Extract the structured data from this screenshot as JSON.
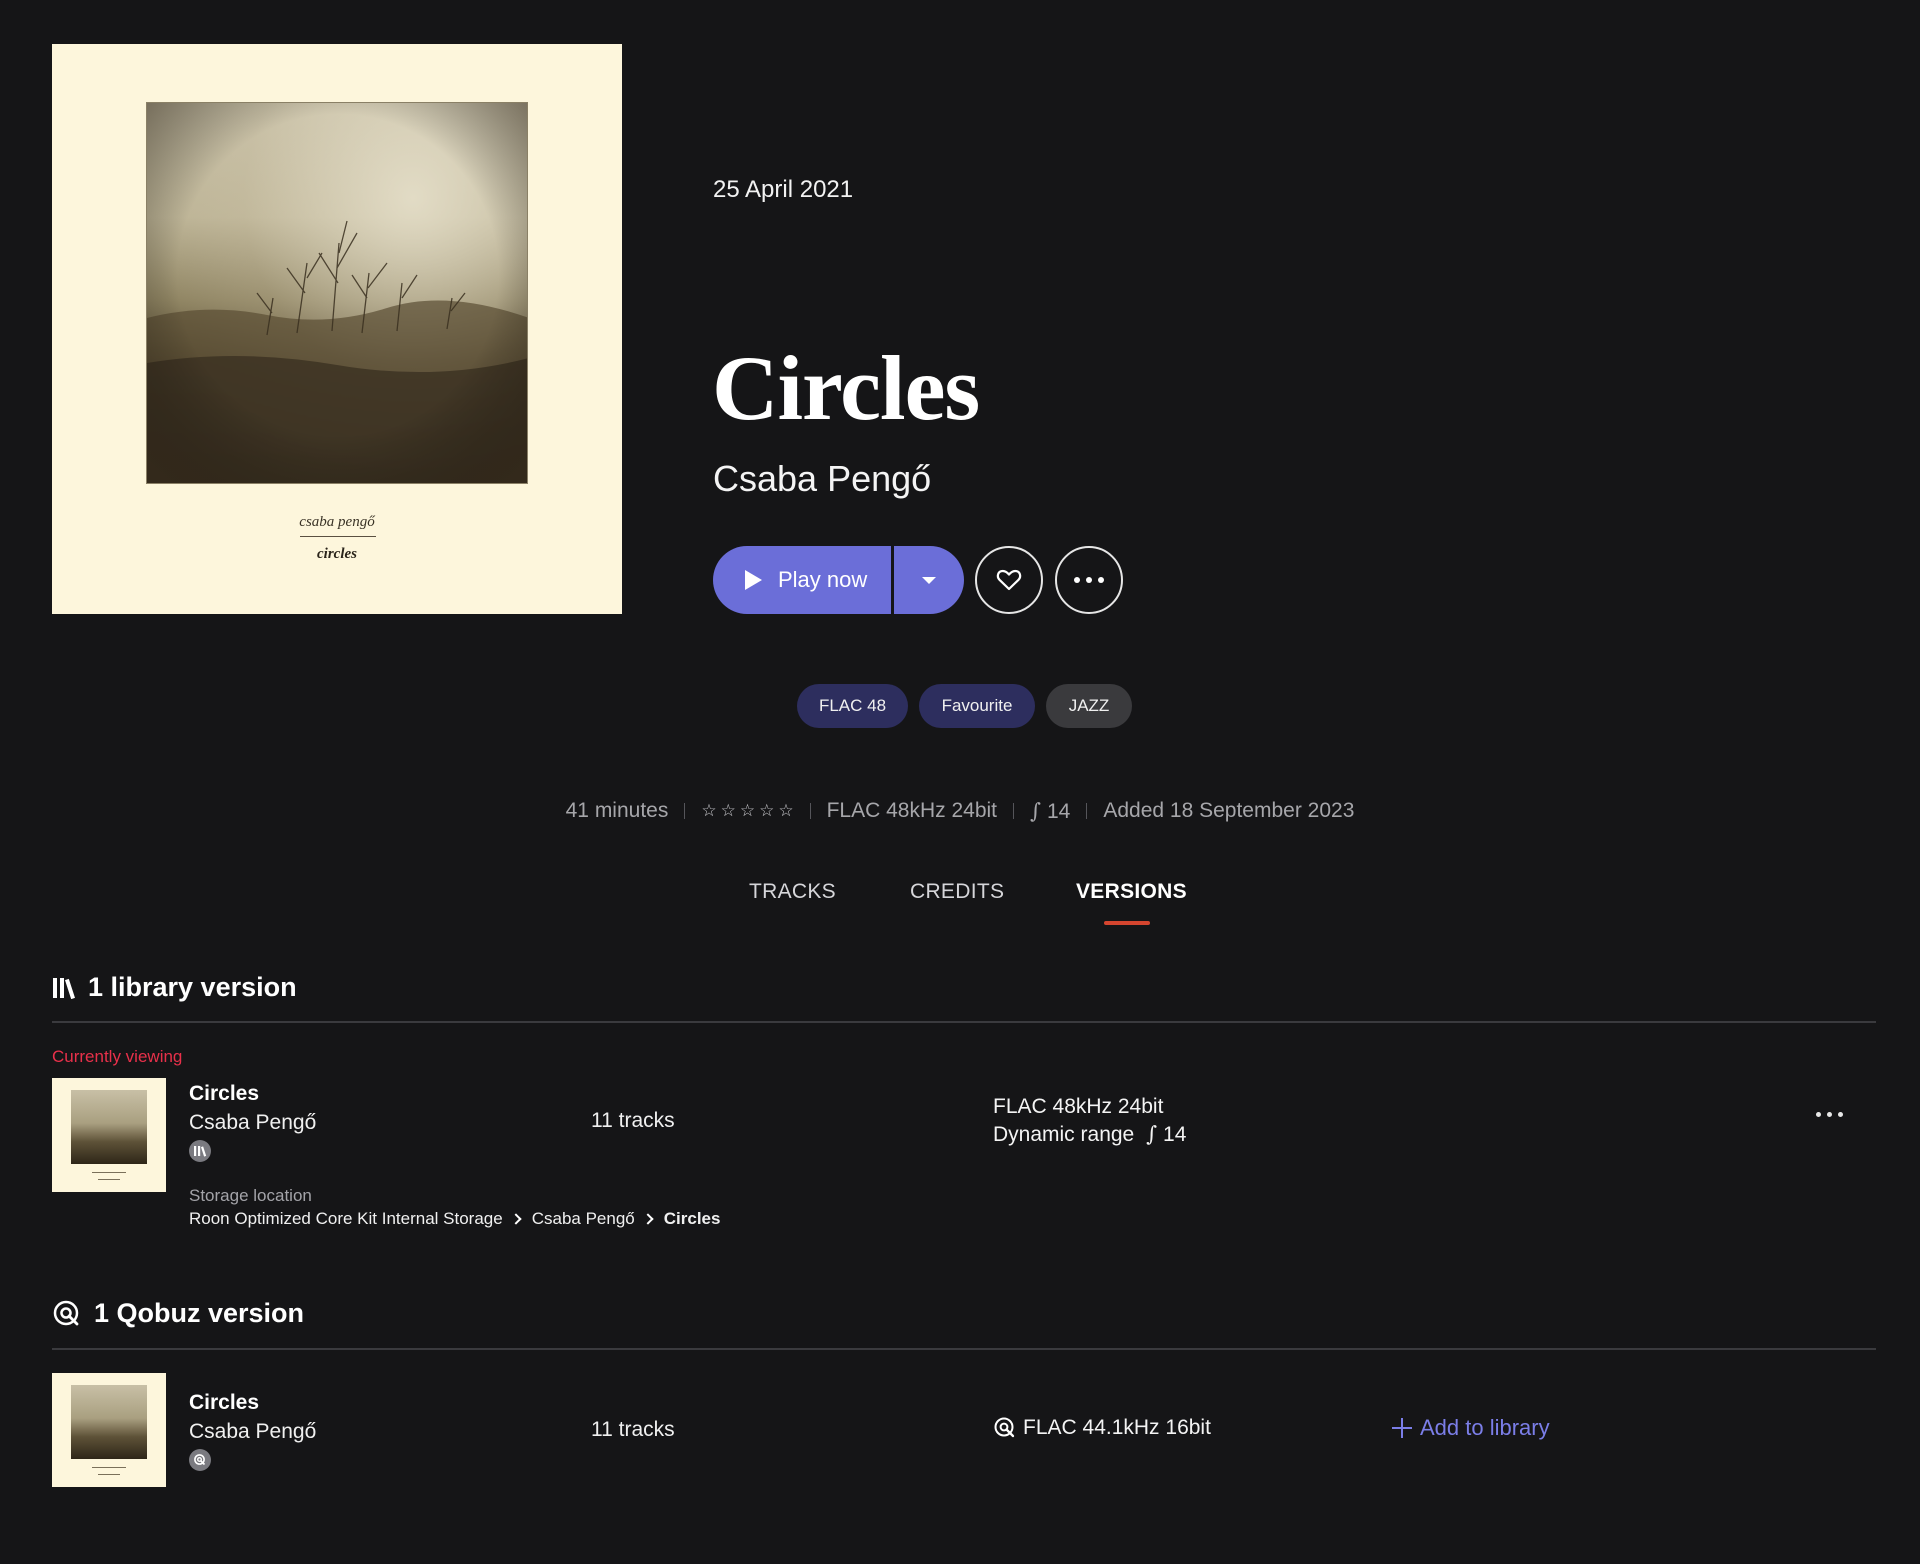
{
  "cover": {
    "artist_text": "csaba pengő",
    "title_text": "circles"
  },
  "album": {
    "release_date": "25 April 2021",
    "title": "Circles",
    "artist": "Csaba Pengő",
    "play_label": "Play now"
  },
  "tags": [
    "FLAC 48",
    "Favourite",
    "JAZZ"
  ],
  "meta": {
    "duration": "41 minutes",
    "rating_stars": 0,
    "format": "FLAC 48kHz 24bit",
    "dynamic_range": "14",
    "added": "Added 18 September 2023"
  },
  "tabs": [
    "TRACKS",
    "CREDITS",
    "VERSIONS"
  ],
  "active_tab": "VERSIONS",
  "library_section": {
    "heading": "1 library version",
    "current_label": "Currently viewing",
    "version": {
      "title": "Circles",
      "artist": "Csaba Pengő",
      "tracks": "11 tracks",
      "format": "FLAC 48kHz 24bit",
      "dynamic_range_label": "Dynamic range",
      "dynamic_range": "14",
      "storage_label": "Storage location",
      "storage_path": [
        "Roon Optimized Core Kit Internal Storage",
        "Csaba Pengő",
        "Circles"
      ]
    }
  },
  "qobuz_section": {
    "heading": "1 Qobuz version",
    "version": {
      "title": "Circles",
      "artist": "Csaba Pengő",
      "tracks": "11 tracks",
      "format": "FLAC 44.1kHz 16bit",
      "add_label": "Add to library"
    }
  },
  "colors": {
    "background": "#151517",
    "accent": "#6b6ed8",
    "tab_underline": "#d5452f",
    "current_label": "#e8304a"
  },
  "icons": [
    "play-icon",
    "chevron-down-icon",
    "heart-icon",
    "more-icon",
    "star-icon",
    "dynamic-range-icon",
    "library-icon",
    "qobuz-icon",
    "chevron-right-icon",
    "plus-icon"
  ]
}
